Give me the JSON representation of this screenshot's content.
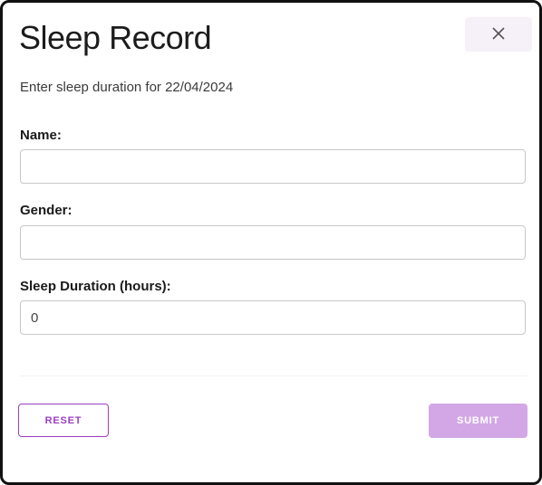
{
  "dialog": {
    "title": "Sleep Record",
    "close_icon": "close-icon",
    "subtitle": "Enter sleep duration for 22/04/2024"
  },
  "form": {
    "name": {
      "label": "Name:",
      "value": ""
    },
    "gender": {
      "label": "Gender:",
      "value": ""
    },
    "sleep_duration": {
      "label": "Sleep Duration (hours):",
      "value": "0"
    }
  },
  "actions": {
    "reset_label": "RESET",
    "submit_label": "SUBMIT"
  },
  "colors": {
    "accent": "#9b3fc0",
    "submit_disabled": "#d3a7e6",
    "close_bg": "#f6f0f9"
  }
}
